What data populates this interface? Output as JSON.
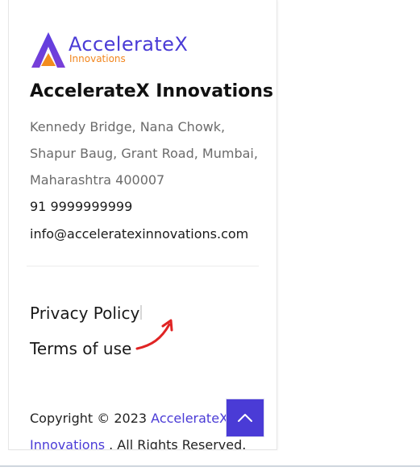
{
  "brand": {
    "logo_word": "AccelerateX",
    "logo_sub": "Innovations",
    "primary_color": "#4a3bd6",
    "accent_color": "#f2861e"
  },
  "company": {
    "name": "AccelerateX Innovations",
    "address_lines": [
      "Kennedy Bridge, Nana Chowk,",
      "Shapur Baug, Grant Road, Mumbai,",
      "Maharashtra 400007"
    ],
    "phone": "91 9999999999",
    "email": "info@acceleratexinnovations.com"
  },
  "footer_links": {
    "privacy": "Privacy Policy",
    "terms": "Terms of use"
  },
  "copyright": {
    "prefix": "Copyright © 2023 ",
    "brand_part1": "AccelerateX",
    "brand_part2": "Innovations",
    "suffix": " . All Rights Reserved."
  },
  "annotation": {
    "arrow_color": "#e02424"
  },
  "icons": {
    "back_to_top": "chevron-up-icon",
    "logo": "acceleratex-logo-icon",
    "annotation": "arrow-annotation-icon"
  }
}
